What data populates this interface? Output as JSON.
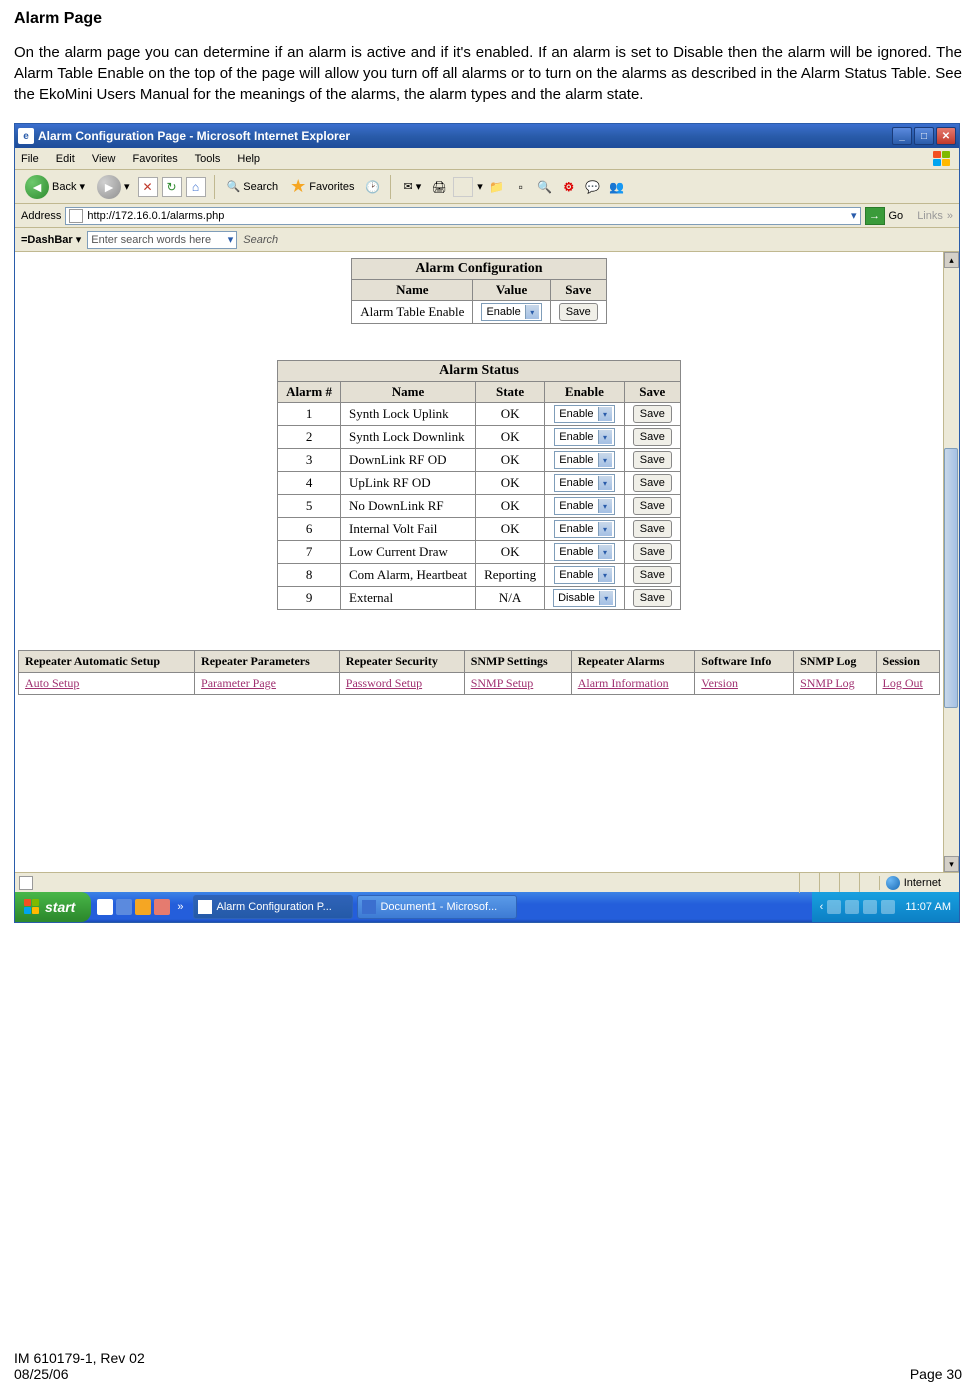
{
  "doc": {
    "heading": "Alarm Page",
    "paragraph": "On the alarm page you can determine if an alarm is active and if it's enabled. If an alarm is set to Disable then the alarm will be ignored.  The Alarm Table Enable on the top of the page will allow you turn off all alarms or to turn on the alarms as described in the Alarm Status Table. See the EkoMini Users Manual for the meanings of the alarms, the alarm types and the alarm state.",
    "footer_left_1": "IM 610179-1, Rev 02",
    "footer_left_2": "08/25/06",
    "footer_right": "Page 30"
  },
  "titlebar": {
    "title": "Alarm Configuration Page - Microsoft Internet Explorer"
  },
  "menubar": {
    "items": [
      "File",
      "Edit",
      "View",
      "Favorites",
      "Tools",
      "Help"
    ]
  },
  "toolbar": {
    "back": "Back",
    "search": "Search",
    "favorites": "Favorites"
  },
  "address": {
    "label": "Address",
    "url": "http://172.16.0.1/alarms.php",
    "go": "Go",
    "links": "Links"
  },
  "dashbar": {
    "label": "=DashBar",
    "placeholder": "Enter search words here",
    "search": "Search"
  },
  "config_table": {
    "caption": "Alarm Configuration",
    "headers": [
      "Name",
      "Value",
      "Save"
    ],
    "row": {
      "name": "Alarm Table Enable",
      "value": "Enable",
      "save": "Save"
    }
  },
  "status_table": {
    "caption": "Alarm Status",
    "headers": [
      "Alarm #",
      "Name",
      "State",
      "Enable",
      "Save"
    ],
    "rows": [
      {
        "num": "1",
        "name": "Synth Lock Uplink",
        "state": "OK",
        "enable": "Enable",
        "save": "Save"
      },
      {
        "num": "2",
        "name": "Synth Lock Downlink",
        "state": "OK",
        "enable": "Enable",
        "save": "Save"
      },
      {
        "num": "3",
        "name": "DownLink RF OD",
        "state": "OK",
        "enable": "Enable",
        "save": "Save"
      },
      {
        "num": "4",
        "name": "UpLink RF OD",
        "state": "OK",
        "enable": "Enable",
        "save": "Save"
      },
      {
        "num": "5",
        "name": "No DownLink RF",
        "state": "OK",
        "enable": "Enable",
        "save": "Save"
      },
      {
        "num": "6",
        "name": "Internal Volt Fail",
        "state": "OK",
        "enable": "Enable",
        "save": "Save"
      },
      {
        "num": "7",
        "name": "Low Current Draw",
        "state": "OK",
        "enable": "Enable",
        "save": "Save"
      },
      {
        "num": "8",
        "name": "Com Alarm, Heartbeat",
        "state": "Reporting",
        "enable": "Enable",
        "save": "Save"
      },
      {
        "num": "9",
        "name": "External",
        "state": "N/A",
        "enable": "Disable",
        "save": "Save"
      }
    ]
  },
  "nav_table": {
    "headers": [
      "Repeater Automatic Setup",
      "Repeater Parameters",
      "Repeater Security",
      "SNMP Settings",
      "Repeater Alarms",
      "Software Info",
      "SNMP Log",
      "Session"
    ],
    "links": [
      "Auto Setup",
      "Parameter Page",
      "Password Setup",
      "SNMP Setup",
      "Alarm Information",
      "Version",
      "SNMP Log",
      "Log Out"
    ]
  },
  "statusbar": {
    "internet": "Internet"
  },
  "taskbar": {
    "start": "start",
    "tasks": [
      "Alarm Configuration P...",
      "Document1 - Microsof..."
    ],
    "clock": "11:07 AM"
  }
}
